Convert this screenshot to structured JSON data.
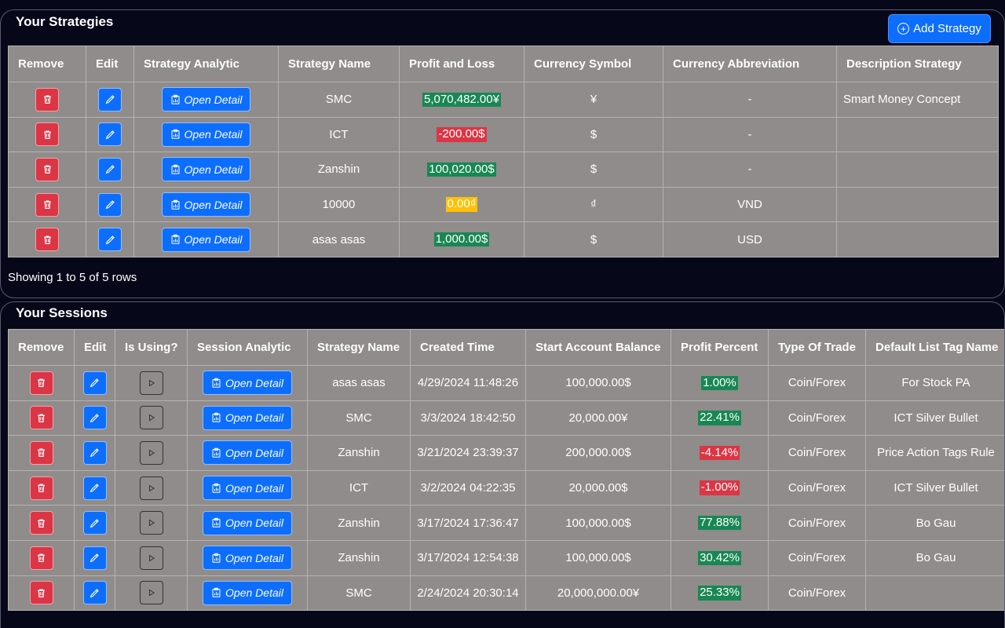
{
  "colors": {
    "background": "#07071a",
    "table_bg": "#8f8c8b",
    "primary": "#0d6efd",
    "danger": "#dc3545",
    "success": "#198754",
    "warning": "#ffc107"
  },
  "strategies": {
    "title": "Your Strategies",
    "add_button_label": "Add Strategy",
    "columns": [
      "Remove",
      "Edit",
      "Strategy Analytic",
      "Strategy Name",
      "Profit and Loss",
      "Currency Symbol",
      "Currency Abbreviation",
      "Description Strategy"
    ],
    "open_detail_label": "Open Detail",
    "rows": [
      {
        "name": "SMC",
        "pnl": "5,070,482.00¥",
        "pnl_status": "green",
        "symbol": "¥",
        "abbreviation": "-",
        "description": "Smart Money Concept"
      },
      {
        "name": "ICT",
        "pnl": "-200.00$",
        "pnl_status": "red",
        "symbol": "$",
        "abbreviation": "-",
        "description": ""
      },
      {
        "name": "Zanshin",
        "pnl": "100,020.00$",
        "pnl_status": "green",
        "symbol": "$",
        "abbreviation": "-",
        "description": ""
      },
      {
        "name": "10000",
        "pnl": "0.00₫",
        "pnl_status": "yellow",
        "symbol": "₫",
        "abbreviation": "VND",
        "description": ""
      },
      {
        "name": "asas asas",
        "pnl": "1,000.00$",
        "pnl_status": "green",
        "symbol": "$",
        "abbreviation": "USD",
        "description": ""
      }
    ],
    "showing_text": "Showing 1 to 5 of 5 rows"
  },
  "sessions": {
    "title": "Your Sessions",
    "columns": [
      "Remove",
      "Edit",
      "Is Using?",
      "Session Analytic",
      "Strategy Name",
      "Created Time",
      "Start Account Balance",
      "Profit Percent",
      "Type Of Trade",
      "Default List Tag Name"
    ],
    "open_detail_label": "Open Detail",
    "rows": [
      {
        "strategy": "asas asas",
        "created": "4/29/2024 11:48:26",
        "balance": "100,000.00$",
        "profit": "1.00%",
        "profit_status": "green",
        "trade_type": "Coin/Forex",
        "tag": "For Stock PA"
      },
      {
        "strategy": "SMC",
        "created": "3/3/2024 18:42:50",
        "balance": "20,000.00¥",
        "profit": "22.41%",
        "profit_status": "green",
        "trade_type": "Coin/Forex",
        "tag": "ICT Silver Bullet"
      },
      {
        "strategy": "Zanshin",
        "created": "3/21/2024 23:39:37",
        "balance": "200,000.00$",
        "profit": "-4.14%",
        "profit_status": "red",
        "trade_type": "Coin/Forex",
        "tag": "Price Action Tags Rule"
      },
      {
        "strategy": "ICT",
        "created": "3/2/2024 04:22:35",
        "balance": "20,000.00$",
        "profit": "-1.00%",
        "profit_status": "red",
        "trade_type": "Coin/Forex",
        "tag": "ICT Silver Bullet"
      },
      {
        "strategy": "Zanshin",
        "created": "3/17/2024 17:36:47",
        "balance": "100,000.00$",
        "profit": "77.88%",
        "profit_status": "green",
        "trade_type": "Coin/Forex",
        "tag": "Bo Gau"
      },
      {
        "strategy": "Zanshin",
        "created": "3/17/2024 12:54:38",
        "balance": "100,000.00$",
        "profit": "30.42%",
        "profit_status": "green",
        "trade_type": "Coin/Forex",
        "tag": "Bo Gau"
      },
      {
        "strategy": "SMC",
        "created": "2/24/2024 20:30:14",
        "balance": "20,000,000.00¥",
        "profit": "25.33%",
        "profit_status": "green",
        "trade_type": "Coin/Forex",
        "tag": ""
      }
    ]
  }
}
